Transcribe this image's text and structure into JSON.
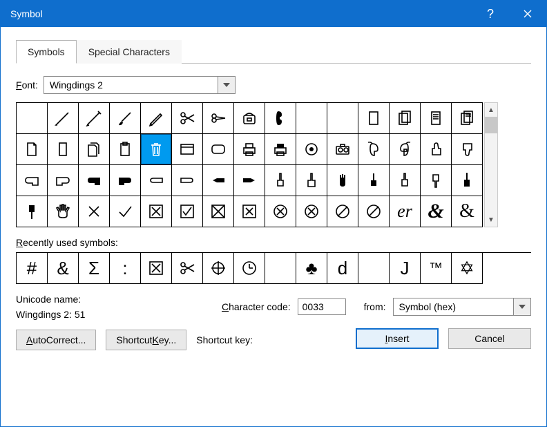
{
  "title": "Symbol",
  "tabs": {
    "symbols": "Symbols",
    "special": "Special Characters"
  },
  "font_label": "Font:",
  "font_value": "Wingdings 2",
  "grid_names": [
    "blank",
    "pen-1",
    "pen-2",
    "brush",
    "pencil",
    "scissors-open",
    "scissors-closed",
    "telephone",
    "handset",
    "blank-2",
    "blank-3",
    "page",
    "pages",
    "document",
    "documents",
    "page-blank",
    "page-thin",
    "pages-2",
    "clipboard",
    "trash-can",
    "window",
    "rounded-rect",
    "printer",
    "printer-2",
    "record",
    "camera",
    "mouse-1",
    "mouse-2",
    "thumbs-up",
    "thumbs-down",
    "hand-left-outline",
    "hand-right-outline",
    "hand-left-solid",
    "hand-right-solid",
    "hand-left-2",
    "hand-right-2",
    "point-left",
    "point-right",
    "finger-up-1",
    "finger-up-2",
    "hand-stop",
    "finger-up-3",
    "finger-up-4",
    "point-down",
    "point-up-solid",
    "point-down-solid",
    "hand-spread",
    "x-mark",
    "check-mark",
    "ballot-x",
    "ballot-check",
    "box-x-1",
    "box-x-2",
    "circle-x",
    "circle-x-thin",
    "prohibited",
    "prohibited-2",
    "er-script",
    "ampersand-bold",
    "ampersand-outline"
  ],
  "selected_index": 19,
  "recent_label": "Recently used symbols:",
  "recent": [
    "#",
    "&",
    "Σ",
    ":",
    "☒",
    "✂",
    "⊕",
    "clock",
    "",
    "♣",
    "d",
    "",
    "J",
    "™",
    "✡"
  ],
  "unicode_name_label": "Unicode name:",
  "unicode_name_value": "Wingdings 2: 51",
  "charcode_label": "Character code:",
  "charcode_value": "0033",
  "from_label": "from:",
  "from_value": "Symbol (hex)",
  "autocorrect_label": "AutoCorrect...",
  "shortcutkey_btn": "Shortcut Key...",
  "shortcutkey_label": "Shortcut key:",
  "insert_label": "Insert",
  "cancel_label": "Cancel"
}
